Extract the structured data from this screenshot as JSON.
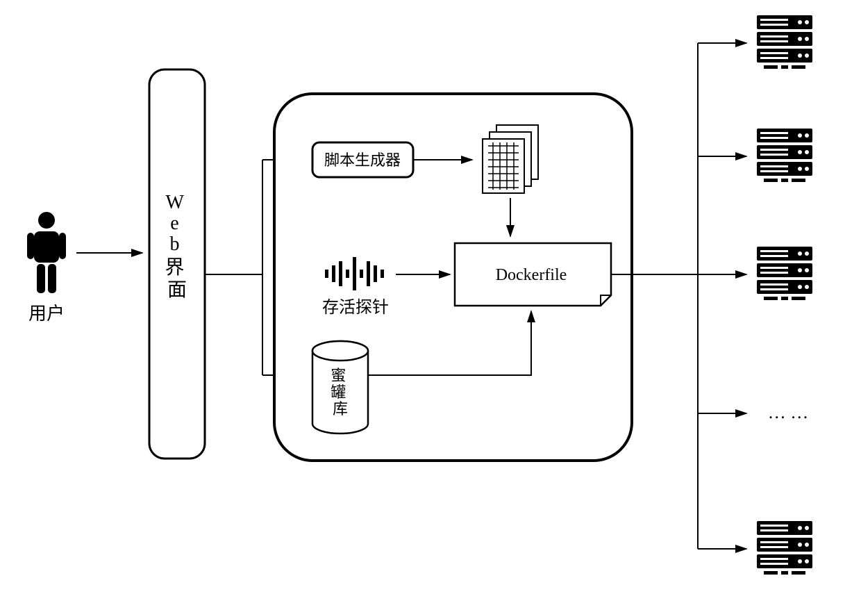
{
  "labels": {
    "user": "用户",
    "webInterface": "Web界面",
    "scriptGenerator": "脚本生成器",
    "livenessProbe": "存活探针",
    "honeypotLibrary": "蜜罐库",
    "dockerfile": "Dockerfile",
    "ellipsis": "…  …"
  }
}
